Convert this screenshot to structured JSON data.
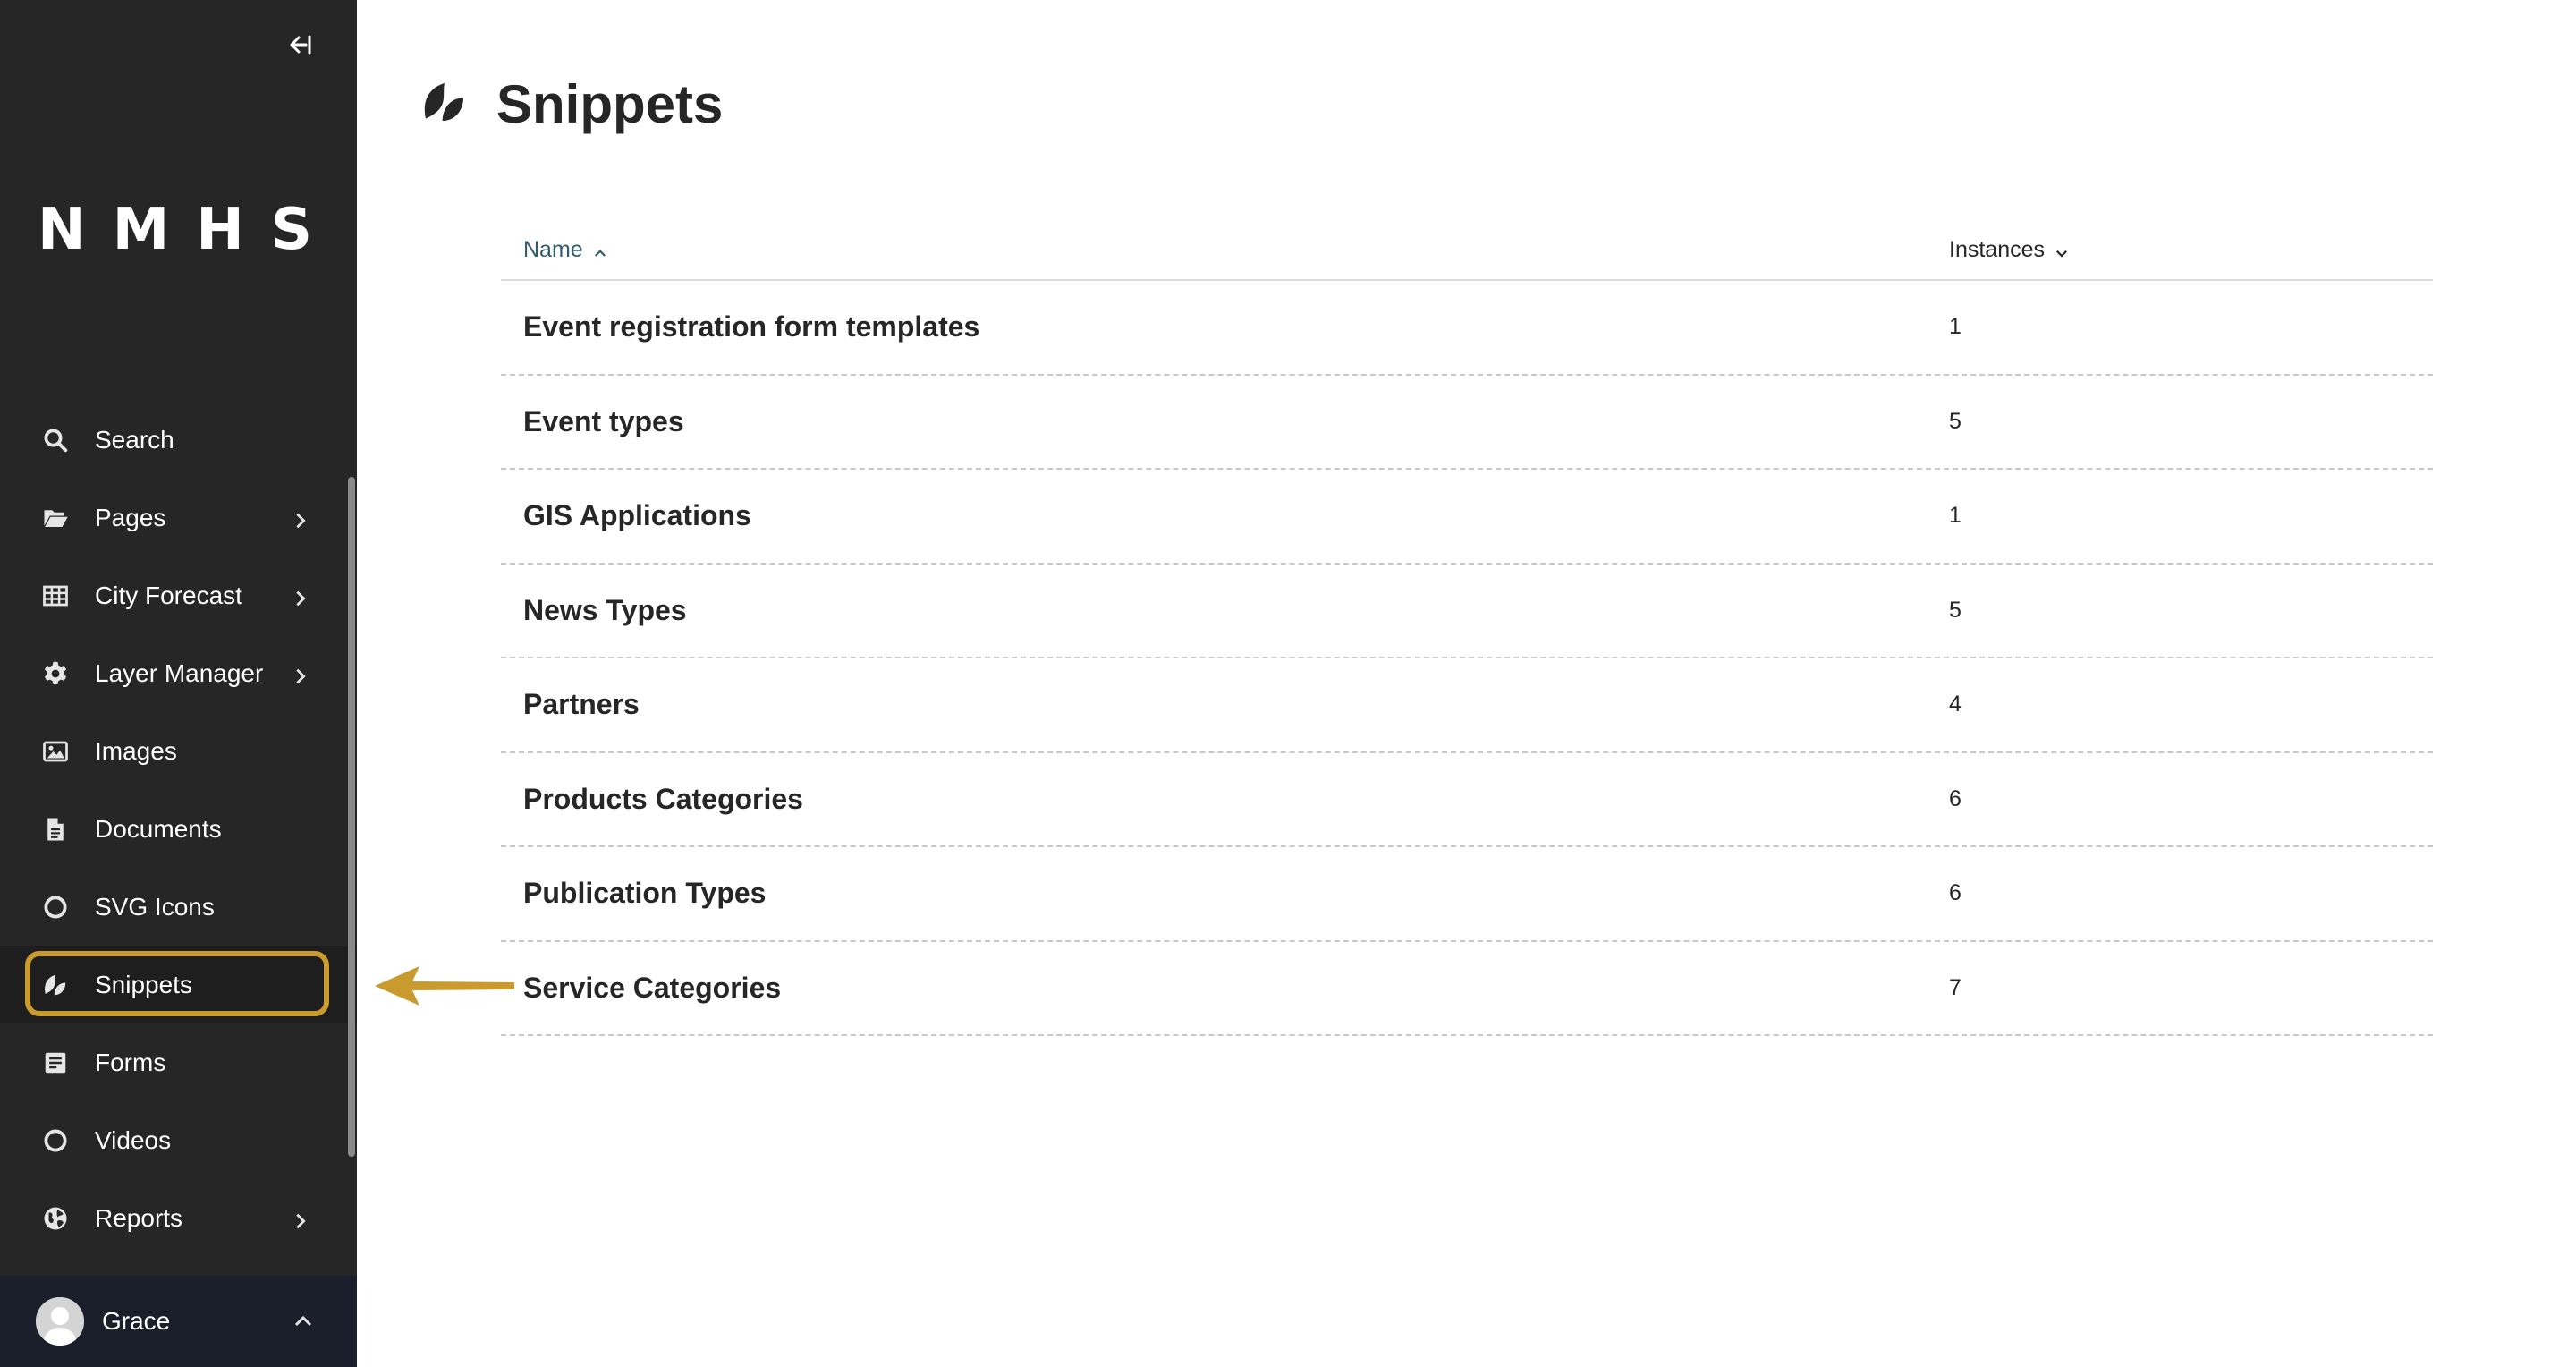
{
  "sidebar": {
    "logo": "NMHS",
    "items": [
      {
        "label": "Search",
        "icon": "search-icon",
        "has_children": false
      },
      {
        "label": "Pages",
        "icon": "folder-open-icon",
        "has_children": true
      },
      {
        "label": "City Forecast",
        "icon": "table-icon",
        "has_children": true
      },
      {
        "label": "Layer Manager",
        "icon": "cog-icon",
        "has_children": true
      },
      {
        "label": "Images",
        "icon": "image-icon",
        "has_children": false
      },
      {
        "label": "Documents",
        "icon": "document-icon",
        "has_children": false
      },
      {
        "label": "SVG Icons",
        "icon": "circle-icon",
        "has_children": false
      },
      {
        "label": "Snippets",
        "icon": "snippet-icon",
        "has_children": false,
        "active": true
      },
      {
        "label": "Forms",
        "icon": "form-icon",
        "has_children": false
      },
      {
        "label": "Videos",
        "icon": "circle-icon",
        "has_children": false
      },
      {
        "label": "Reports",
        "icon": "globe-icon",
        "has_children": true
      }
    ],
    "account": {
      "name": "Grace"
    }
  },
  "header": {
    "title": "Snippets"
  },
  "table": {
    "columns": {
      "name": "Name",
      "instances": "Instances"
    },
    "rows": [
      {
        "name": "Event registration form templates",
        "count": "1"
      },
      {
        "name": "Event types",
        "count": "5"
      },
      {
        "name": "GIS Applications",
        "count": "1"
      },
      {
        "name": "News Types",
        "count": "5"
      },
      {
        "name": "Partners",
        "count": "4"
      },
      {
        "name": "Products Categories",
        "count": "6"
      },
      {
        "name": "Publication Types",
        "count": "6"
      },
      {
        "name": "Service Categories",
        "count": "7"
      }
    ]
  },
  "colors": {
    "sidebar_bg": "#262626",
    "account_bg": "#1a1f2b",
    "highlight": "#c99a2e",
    "link_teal": "#2e5c6e"
  }
}
